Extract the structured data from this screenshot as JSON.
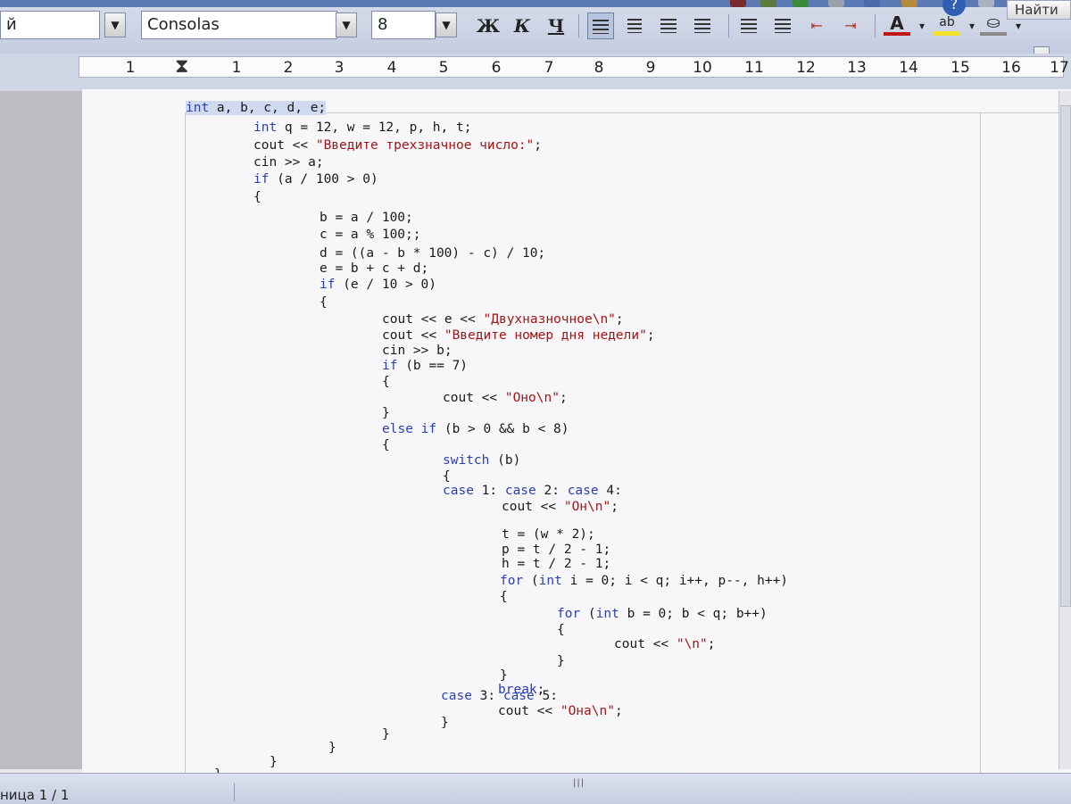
{
  "toolbar": {
    "style_partial": "й",
    "font_name": "Consolas",
    "font_size": "8",
    "bold_label": "Ж",
    "italic_label": "К",
    "underline_label": "Ч",
    "find_label": "Найти",
    "help_label": "?",
    "dropdown_glyph": "▼",
    "split_glyph": "▾"
  },
  "ruler": {
    "marks": [
      "1",
      "1",
      "2",
      "3",
      "4",
      "5",
      "6",
      "7",
      "8",
      "9",
      "10",
      "11",
      "12",
      "13",
      "14",
      "15",
      "16",
      "17"
    ]
  },
  "code": {
    "lines": [
      [
        {
          "t": "int",
          "c": "kw"
        },
        {
          "t": " a, b, c, d, e;"
        }
      ],
      [
        {
          "t": "int",
          "c": "kw"
        },
        {
          "t": " q = 12, w = 12, p, h, t;"
        }
      ],
      [
        {
          "t": "cout << "
        },
        {
          "t": "\"Введите трехзначное число:\"",
          "c": "str"
        },
        {
          "t": ";"
        }
      ],
      [
        {
          "t": "cin >> a;"
        }
      ],
      [
        {
          "t": "if",
          "c": "kw"
        },
        {
          "t": " (a / 100 > 0)"
        }
      ],
      [
        {
          "t": "{"
        }
      ],
      [
        {
          "t": "b = a / 100;"
        }
      ],
      [
        {
          "t": "c = a % 100;;"
        }
      ],
      [
        {
          "t": "d = ((a - b * 100) - c) / 10;"
        }
      ],
      [
        {
          "t": "e = b + c + d;"
        }
      ],
      [
        {
          "t": "if",
          "c": "kw"
        },
        {
          "t": " (e / 10 > 0)"
        }
      ],
      [
        {
          "t": "{"
        }
      ],
      [
        {
          "t": "cout << e << "
        },
        {
          "t": "\"Двухназночное\\n\"",
          "c": "str"
        },
        {
          "t": ";"
        }
      ],
      [
        {
          "t": "cout << "
        },
        {
          "t": "\"Введите номер дня недели\"",
          "c": "str"
        },
        {
          "t": ";"
        }
      ],
      [
        {
          "t": "cin >> b;"
        }
      ],
      [
        {
          "t": "if",
          "c": "kw"
        },
        {
          "t": " (b == 7)"
        }
      ],
      [
        {
          "t": "{"
        }
      ],
      [
        {
          "t": "cout << "
        },
        {
          "t": "\"Оно\\n\"",
          "c": "str"
        },
        {
          "t": ";"
        }
      ],
      [
        {
          "t": "}"
        }
      ],
      [
        {
          "t": "else if",
          "c": "kw"
        },
        {
          "t": " (b > 0 && b < 8)"
        }
      ],
      [
        {
          "t": "{"
        }
      ],
      [
        {
          "t": "switch",
          "c": "kw"
        },
        {
          "t": " (b)"
        }
      ],
      [
        {
          "t": "{"
        }
      ],
      [
        {
          "t": "case",
          "c": "kw"
        },
        {
          "t": " 1: "
        },
        {
          "t": "case",
          "c": "kw"
        },
        {
          "t": " 2: "
        },
        {
          "t": "case",
          "c": "kw"
        },
        {
          "t": " 4:"
        }
      ],
      [
        {
          "t": "cout << "
        },
        {
          "t": "\"Он\\n\"",
          "c": "str"
        },
        {
          "t": ";"
        }
      ],
      [
        {
          "t": "t = (w * 2);"
        }
      ],
      [
        {
          "t": "p = t / 2 - 1;"
        }
      ],
      [
        {
          "t": "h = t / 2 - 1;"
        }
      ],
      [
        {
          "t": "for",
          "c": "kw"
        },
        {
          "t": " ("
        },
        {
          "t": "int",
          "c": "kw"
        },
        {
          "t": " i = 0; i < q; i++, p--, h++)"
        }
      ],
      [
        {
          "t": "{"
        }
      ],
      [
        {
          "t": "for",
          "c": "kw"
        },
        {
          "t": " ("
        },
        {
          "t": "int",
          "c": "kw"
        },
        {
          "t": " b = 0; b < q; b++)"
        }
      ],
      [
        {
          "t": "{"
        }
      ],
      [
        {
          "t": "cout << "
        },
        {
          "t": "\"\\n\"",
          "c": "str"
        },
        {
          "t": ";"
        }
      ],
      [
        {
          "t": "}"
        }
      ],
      [
        {
          "t": "}"
        }
      ],
      [
        {
          "t": "break",
          "c": "kw"
        },
        {
          "t": ";"
        }
      ],
      [
        {
          "t": "case",
          "c": "kw"
        },
        {
          "t": " 3: "
        },
        {
          "t": "case",
          "c": "kw"
        },
        {
          "t": " 5:"
        }
      ],
      [
        {
          "t": "cout << "
        },
        {
          "t": "\"Она\\n\"",
          "c": "str"
        },
        {
          "t": ";"
        }
      ],
      [
        {
          "t": "}"
        }
      ],
      [
        {
          "t": "}"
        }
      ],
      [
        {
          "t": "}"
        }
      ],
      [
        {
          "t": "}"
        }
      ],
      [
        {
          "t": "}"
        }
      ]
    ]
  },
  "status": {
    "page_label": "ница 1 / 1",
    "grip": "|||"
  }
}
